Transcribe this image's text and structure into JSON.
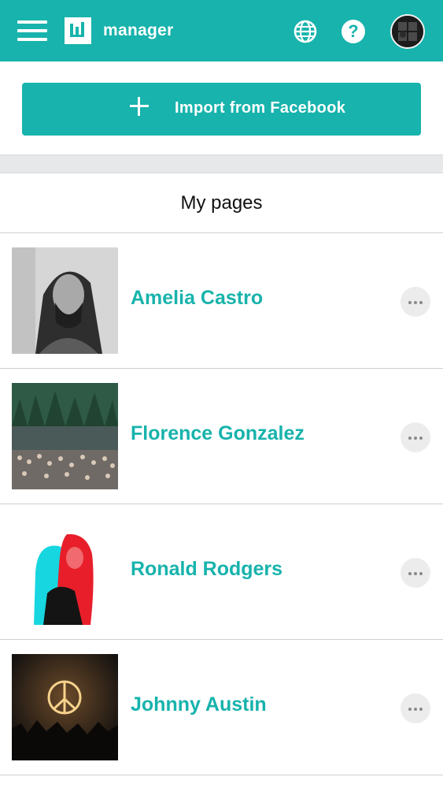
{
  "header": {
    "app_name": "manager",
    "icons": [
      "menu-icon",
      "brand-logo-icon",
      "globe-icon",
      "help-icon",
      "user-avatar"
    ]
  },
  "actions": {
    "import_label": "Import from Facebook",
    "import_icon": "plus-icon"
  },
  "section": {
    "title": "My pages"
  },
  "pages": [
    {
      "name": "Amelia Castro"
    },
    {
      "name": "Florence Gonzalez"
    },
    {
      "name": "Ronald Rodgers"
    },
    {
      "name": "Johnny Austin"
    }
  ],
  "colors": {
    "brand": "#17b3ac",
    "background": "#ffffff",
    "band": "#e6e8ea"
  }
}
